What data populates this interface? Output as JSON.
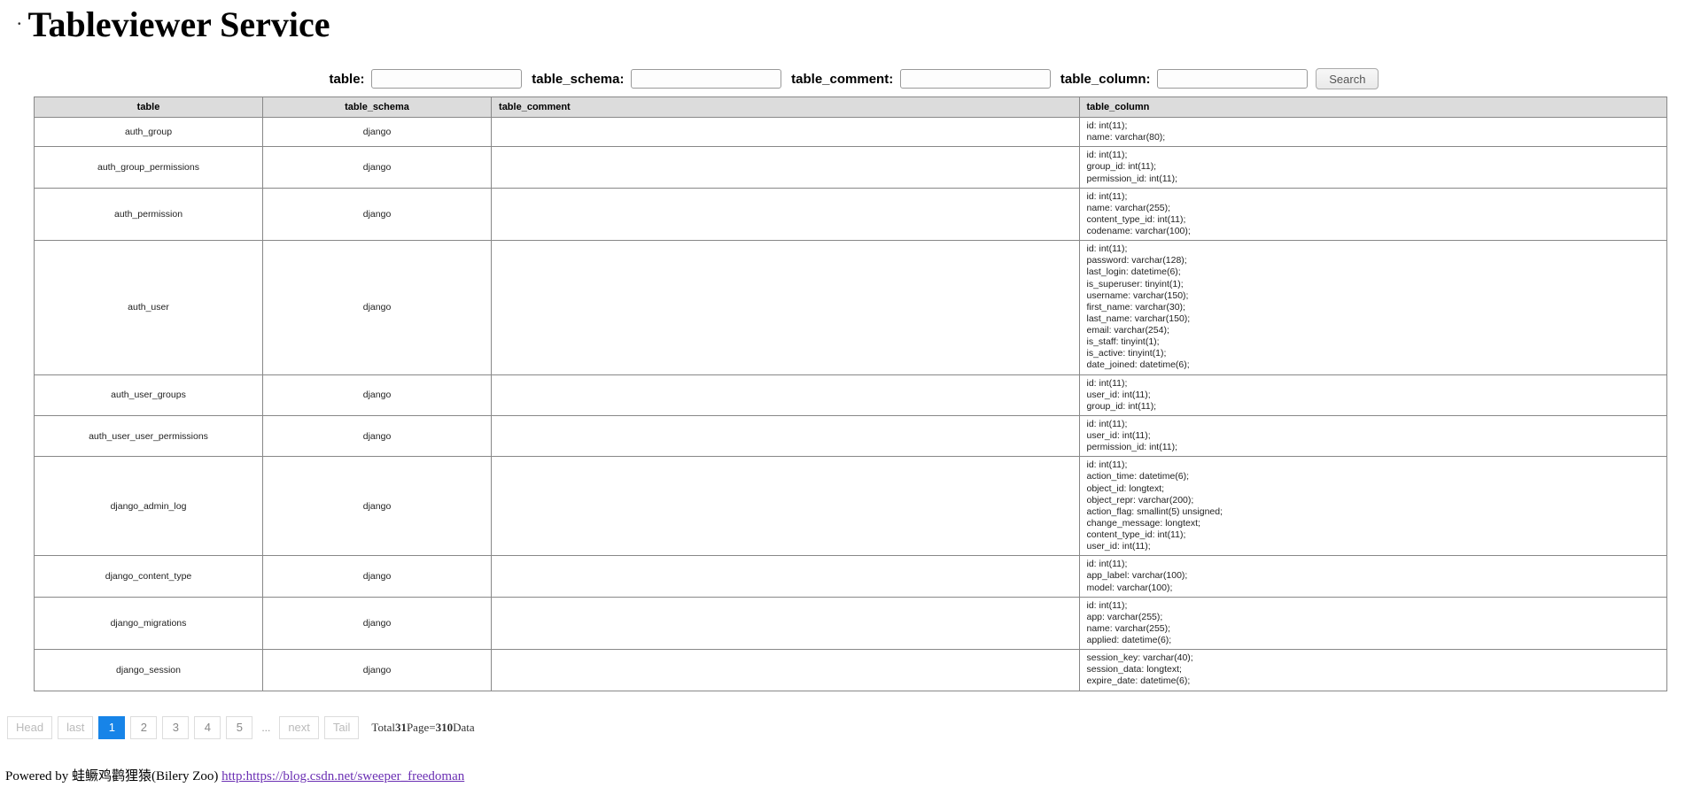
{
  "header": {
    "title": "Tableviewer Service"
  },
  "search": {
    "fields": {
      "table": {
        "label": "table:",
        "value": ""
      },
      "schema": {
        "label": "table_schema:",
        "value": ""
      },
      "comment": {
        "label": "table_comment:",
        "value": ""
      },
      "column": {
        "label": "table_column:",
        "value": ""
      }
    },
    "button": "Search"
  },
  "columns": {
    "table": "table",
    "schema": "table_schema",
    "comment": "table_comment",
    "column": "table_column"
  },
  "rows": [
    {
      "table": "auth_group",
      "schema": "django",
      "comment": "",
      "column": "id: int(11);\nname: varchar(80);"
    },
    {
      "table": "auth_group_permissions",
      "schema": "django",
      "comment": "",
      "column": "id: int(11);\ngroup_id: int(11);\npermission_id: int(11);"
    },
    {
      "table": "auth_permission",
      "schema": "django",
      "comment": "",
      "column": "id: int(11);\nname: varchar(255);\ncontent_type_id: int(11);\ncodename: varchar(100);"
    },
    {
      "table": "auth_user",
      "schema": "django",
      "comment": "",
      "column": "id: int(11);\npassword: varchar(128);\nlast_login: datetime(6);\nis_superuser: tinyint(1);\nusername: varchar(150);\nfirst_name: varchar(30);\nlast_name: varchar(150);\nemail: varchar(254);\nis_staff: tinyint(1);\nis_active: tinyint(1);\ndate_joined: datetime(6);"
    },
    {
      "table": "auth_user_groups",
      "schema": "django",
      "comment": "",
      "column": "id: int(11);\nuser_id: int(11);\ngroup_id: int(11);"
    },
    {
      "table": "auth_user_user_permissions",
      "schema": "django",
      "comment": "",
      "column": "id: int(11);\nuser_id: int(11);\npermission_id: int(11);"
    },
    {
      "table": "django_admin_log",
      "schema": "django",
      "comment": "",
      "column": "id: int(11);\naction_time: datetime(6);\nobject_id: longtext;\nobject_repr: varchar(200);\naction_flag: smallint(5) unsigned;\nchange_message: longtext;\ncontent_type_id: int(11);\nuser_id: int(11);"
    },
    {
      "table": "django_content_type",
      "schema": "django",
      "comment": "",
      "column": "id: int(11);\napp_label: varchar(100);\nmodel: varchar(100);"
    },
    {
      "table": "django_migrations",
      "schema": "django",
      "comment": "",
      "column": "id: int(11);\napp: varchar(255);\nname: varchar(255);\napplied: datetime(6);"
    },
    {
      "table": "django_session",
      "schema": "django",
      "comment": "",
      "column": "session_key: varchar(40);\nsession_data: longtext;\nexpire_date: datetime(6);"
    }
  ],
  "pager": {
    "head": "Head",
    "last": "last",
    "pages": [
      "1",
      "2",
      "3",
      "4",
      "5"
    ],
    "active_index": 0,
    "ellipsis": "...",
    "next": "next",
    "tail": "Tail",
    "summary_prefix": "Total",
    "total_pages": "31",
    "summary_mid": "Page=",
    "total_data": "310",
    "summary_suffix": "Data"
  },
  "footer": {
    "prefix": "Powered by 蛙鳜鸡鹳狸猿(Bilery Zoo) ",
    "link_text": "http:https://blog.csdn.net/sweeper_freedoman",
    "link_href": "#"
  }
}
